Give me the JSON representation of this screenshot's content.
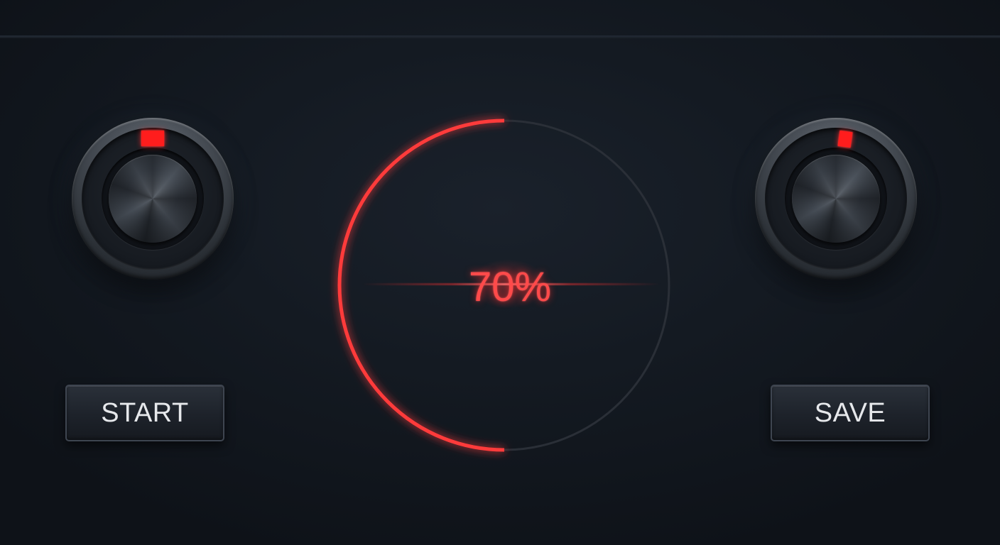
{
  "progress": {
    "label": "70%",
    "value": 0.5,
    "accent_color": "#ff3b3b",
    "track_color": "#2a2f37"
  },
  "knobs": [
    {
      "name": "left-knob",
      "indicator_color": "#ff1d1d"
    },
    {
      "name": "right-knob",
      "indicator_color": "#ff1d1d"
    }
  ],
  "buttons": {
    "start_label": "START",
    "save_label": "SAVE"
  }
}
